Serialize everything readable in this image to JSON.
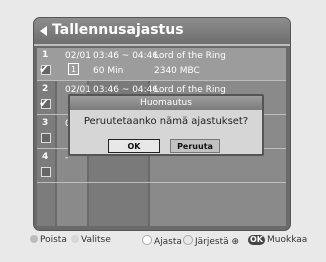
{
  "window": {
    "title": "Tallennusajastus"
  },
  "rows": [
    {
      "num": "1",
      "date": "02/01",
      "time": "03:46 ~ 04:46",
      "duration": "60 Min",
      "name": "Lord of the Ring",
      "channel": "2340 MBC",
      "checked": true
    },
    {
      "num": "2",
      "date": "02/01",
      "time": "03:46 ~ 04:46",
      "duration": "",
      "name": "Lord of the Ring",
      "channel": "",
      "checked": true
    },
    {
      "num": "3",
      "date": "0",
      "time": "",
      "duration": "",
      "name": "",
      "channel": "",
      "checked": false
    },
    {
      "num": "4",
      "date": "-",
      "time": "",
      "duration": "",
      "name": "",
      "channel": "",
      "checked": false
    }
  ],
  "dialog": {
    "title": "Huomautus",
    "message": "Peruutetaanko nämä ajastukset?",
    "ok_label": "OK",
    "cancel_label": "Peruuta"
  },
  "footer": {
    "delete_label": "Poista",
    "select_label": "Valitse",
    "schedule_label": "Ajasta",
    "sort_label": "Järjestä",
    "ok_badge": "OK",
    "edit_label": "Muokkaa"
  },
  "colors": {
    "delete_dot": "#bdbdbd",
    "select_dot": "#d8d8d8",
    "schedule_dot": "#ffffff"
  }
}
